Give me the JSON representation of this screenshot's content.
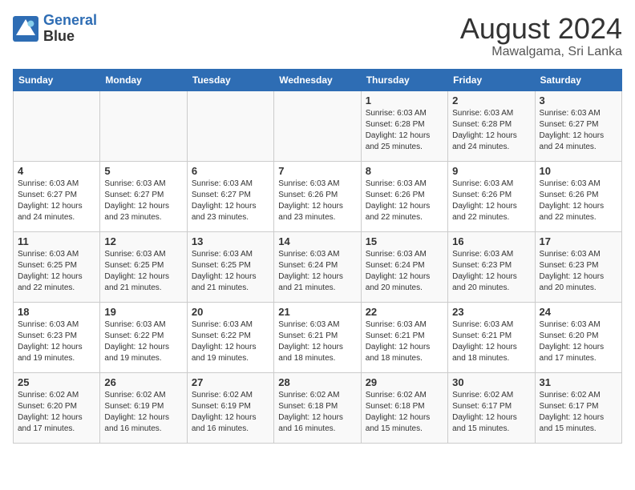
{
  "logo": {
    "line1": "General",
    "line2": "Blue"
  },
  "title": {
    "month_year": "August 2024",
    "location": "Mawalgama, Sri Lanka"
  },
  "days_of_week": [
    "Sunday",
    "Monday",
    "Tuesday",
    "Wednesday",
    "Thursday",
    "Friday",
    "Saturday"
  ],
  "weeks": [
    [
      {
        "day": "",
        "sunrise": "",
        "sunset": "",
        "daylight": ""
      },
      {
        "day": "",
        "sunrise": "",
        "sunset": "",
        "daylight": ""
      },
      {
        "day": "",
        "sunrise": "",
        "sunset": "",
        "daylight": ""
      },
      {
        "day": "",
        "sunrise": "",
        "sunset": "",
        "daylight": ""
      },
      {
        "day": "1",
        "sunrise": "Sunrise: 6:03 AM",
        "sunset": "Sunset: 6:28 PM",
        "daylight": "Daylight: 12 hours and 25 minutes."
      },
      {
        "day": "2",
        "sunrise": "Sunrise: 6:03 AM",
        "sunset": "Sunset: 6:28 PM",
        "daylight": "Daylight: 12 hours and 24 minutes."
      },
      {
        "day": "3",
        "sunrise": "Sunrise: 6:03 AM",
        "sunset": "Sunset: 6:27 PM",
        "daylight": "Daylight: 12 hours and 24 minutes."
      }
    ],
    [
      {
        "day": "4",
        "sunrise": "Sunrise: 6:03 AM",
        "sunset": "Sunset: 6:27 PM",
        "daylight": "Daylight: 12 hours and 24 minutes."
      },
      {
        "day": "5",
        "sunrise": "Sunrise: 6:03 AM",
        "sunset": "Sunset: 6:27 PM",
        "daylight": "Daylight: 12 hours and 23 minutes."
      },
      {
        "day": "6",
        "sunrise": "Sunrise: 6:03 AM",
        "sunset": "Sunset: 6:27 PM",
        "daylight": "Daylight: 12 hours and 23 minutes."
      },
      {
        "day": "7",
        "sunrise": "Sunrise: 6:03 AM",
        "sunset": "Sunset: 6:26 PM",
        "daylight": "Daylight: 12 hours and 23 minutes."
      },
      {
        "day": "8",
        "sunrise": "Sunrise: 6:03 AM",
        "sunset": "Sunset: 6:26 PM",
        "daylight": "Daylight: 12 hours and 22 minutes."
      },
      {
        "day": "9",
        "sunrise": "Sunrise: 6:03 AM",
        "sunset": "Sunset: 6:26 PM",
        "daylight": "Daylight: 12 hours and 22 minutes."
      },
      {
        "day": "10",
        "sunrise": "Sunrise: 6:03 AM",
        "sunset": "Sunset: 6:26 PM",
        "daylight": "Daylight: 12 hours and 22 minutes."
      }
    ],
    [
      {
        "day": "11",
        "sunrise": "Sunrise: 6:03 AM",
        "sunset": "Sunset: 6:25 PM",
        "daylight": "Daylight: 12 hours and 22 minutes."
      },
      {
        "day": "12",
        "sunrise": "Sunrise: 6:03 AM",
        "sunset": "Sunset: 6:25 PM",
        "daylight": "Daylight: 12 hours and 21 minutes."
      },
      {
        "day": "13",
        "sunrise": "Sunrise: 6:03 AM",
        "sunset": "Sunset: 6:25 PM",
        "daylight": "Daylight: 12 hours and 21 minutes."
      },
      {
        "day": "14",
        "sunrise": "Sunrise: 6:03 AM",
        "sunset": "Sunset: 6:24 PM",
        "daylight": "Daylight: 12 hours and 21 minutes."
      },
      {
        "day": "15",
        "sunrise": "Sunrise: 6:03 AM",
        "sunset": "Sunset: 6:24 PM",
        "daylight": "Daylight: 12 hours and 20 minutes."
      },
      {
        "day": "16",
        "sunrise": "Sunrise: 6:03 AM",
        "sunset": "Sunset: 6:23 PM",
        "daylight": "Daylight: 12 hours and 20 minutes."
      },
      {
        "day": "17",
        "sunrise": "Sunrise: 6:03 AM",
        "sunset": "Sunset: 6:23 PM",
        "daylight": "Daylight: 12 hours and 20 minutes."
      }
    ],
    [
      {
        "day": "18",
        "sunrise": "Sunrise: 6:03 AM",
        "sunset": "Sunset: 6:23 PM",
        "daylight": "Daylight: 12 hours and 19 minutes."
      },
      {
        "day": "19",
        "sunrise": "Sunrise: 6:03 AM",
        "sunset": "Sunset: 6:22 PM",
        "daylight": "Daylight: 12 hours and 19 minutes."
      },
      {
        "day": "20",
        "sunrise": "Sunrise: 6:03 AM",
        "sunset": "Sunset: 6:22 PM",
        "daylight": "Daylight: 12 hours and 19 minutes."
      },
      {
        "day": "21",
        "sunrise": "Sunrise: 6:03 AM",
        "sunset": "Sunset: 6:21 PM",
        "daylight": "Daylight: 12 hours and 18 minutes."
      },
      {
        "day": "22",
        "sunrise": "Sunrise: 6:03 AM",
        "sunset": "Sunset: 6:21 PM",
        "daylight": "Daylight: 12 hours and 18 minutes."
      },
      {
        "day": "23",
        "sunrise": "Sunrise: 6:03 AM",
        "sunset": "Sunset: 6:21 PM",
        "daylight": "Daylight: 12 hours and 18 minutes."
      },
      {
        "day": "24",
        "sunrise": "Sunrise: 6:03 AM",
        "sunset": "Sunset: 6:20 PM",
        "daylight": "Daylight: 12 hours and 17 minutes."
      }
    ],
    [
      {
        "day": "25",
        "sunrise": "Sunrise: 6:02 AM",
        "sunset": "Sunset: 6:20 PM",
        "daylight": "Daylight: 12 hours and 17 minutes."
      },
      {
        "day": "26",
        "sunrise": "Sunrise: 6:02 AM",
        "sunset": "Sunset: 6:19 PM",
        "daylight": "Daylight: 12 hours and 16 minutes."
      },
      {
        "day": "27",
        "sunrise": "Sunrise: 6:02 AM",
        "sunset": "Sunset: 6:19 PM",
        "daylight": "Daylight: 12 hours and 16 minutes."
      },
      {
        "day": "28",
        "sunrise": "Sunrise: 6:02 AM",
        "sunset": "Sunset: 6:18 PM",
        "daylight": "Daylight: 12 hours and 16 minutes."
      },
      {
        "day": "29",
        "sunrise": "Sunrise: 6:02 AM",
        "sunset": "Sunset: 6:18 PM",
        "daylight": "Daylight: 12 hours and 15 minutes."
      },
      {
        "day": "30",
        "sunrise": "Sunrise: 6:02 AM",
        "sunset": "Sunset: 6:17 PM",
        "daylight": "Daylight: 12 hours and 15 minutes."
      },
      {
        "day": "31",
        "sunrise": "Sunrise: 6:02 AM",
        "sunset": "Sunset: 6:17 PM",
        "daylight": "Daylight: 12 hours and 15 minutes."
      }
    ]
  ]
}
